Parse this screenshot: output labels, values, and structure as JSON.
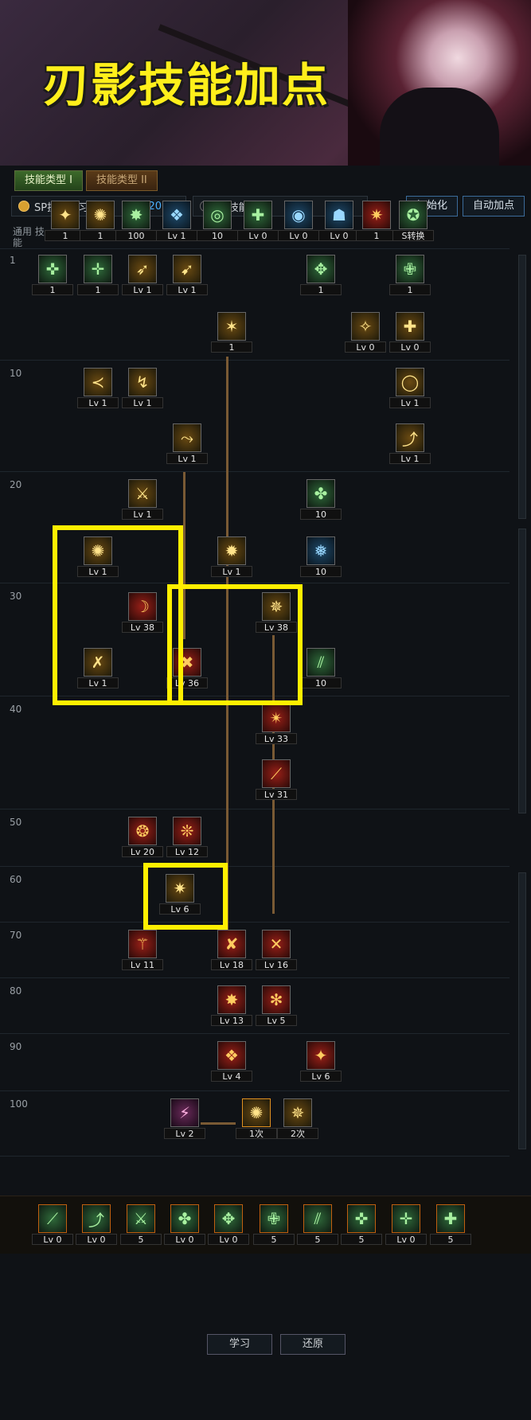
{
  "banner": {
    "title": "刃影技能加点"
  },
  "tabs": [
    "技能类型 I",
    "技能类型 II"
  ],
  "modes": {
    "sp_label": "SP技能学习",
    "sp_value": "120",
    "tp_label": "TP技能学习",
    "tp_value": "1"
  },
  "buttons": {
    "init": "初始化",
    "auto": "自动加点"
  },
  "common_label": "通用 技能",
  "level_labels": [
    "1",
    "10",
    "20",
    "30",
    "40",
    "50",
    "60",
    "70",
    "80",
    "90",
    "100"
  ],
  "common_skills": [
    "1",
    "1",
    "100",
    "Lv 1",
    "10",
    "Lv 0",
    "Lv 0",
    "Lv 0",
    "1",
    "S转换"
  ],
  "tree": {
    "r1": [
      "1",
      "1",
      "Lv 1",
      "Lv 1",
      "1",
      "1"
    ],
    "r1b": [
      "1",
      "Lv 0",
      "Lv 0"
    ],
    "r10": [
      "Lv 1",
      "Lv 1",
      "Lv 1"
    ],
    "r15": [
      "Lv 1",
      "Lv 1"
    ],
    "r20": [
      "Lv 1",
      "10"
    ],
    "r25": [
      "Lv 1",
      "Lv 1",
      "10"
    ],
    "r30": [
      "Lv 38",
      "Lv 38"
    ],
    "r35": [
      "Lv 1",
      "Lv 36",
      "10"
    ],
    "r40": [
      "Lv 33"
    ],
    "r45": [
      "Lv 31"
    ],
    "r50": [
      "Lv 20",
      "Lv 12"
    ],
    "r60": [
      "Lv 6"
    ],
    "r70": [
      "Lv 11",
      "Lv 18",
      "Lv 16"
    ],
    "r80": [
      "Lv 13",
      "Lv 5"
    ],
    "r90": [
      "Lv 4",
      "Lv 6"
    ],
    "r100": [
      "Lv 2",
      "1次",
      "2次"
    ]
  },
  "bottom_buttons": {
    "learn": "学习",
    "restore": "还原"
  },
  "tray": [
    "Lv 0",
    "Lv 0",
    "5",
    "Lv 0",
    "Lv 0",
    "5",
    "5",
    "5",
    "Lv 0",
    "5"
  ]
}
